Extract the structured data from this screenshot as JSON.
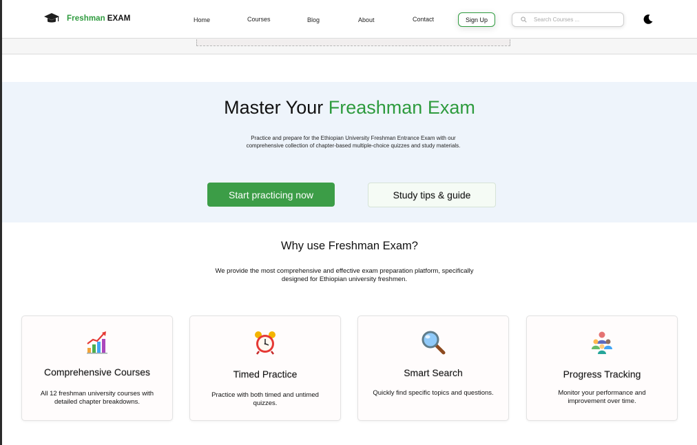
{
  "header": {
    "brand_part1": "Freshman",
    "brand_part2": "EXAM",
    "nav": [
      "Home",
      "Courses",
      "Blog",
      "About",
      "Contact"
    ],
    "signup_label": "Sign Up",
    "search_placeholder": "Search Courses ..."
  },
  "hero": {
    "title_part1": "Master Your",
    "title_part2": "Freashman Exam",
    "subtitle": "Practice and prepare for the Ethiopian University Freshman Entrance Exam with our comprehensive collection of chapter-based multiple-choice quizzes and study materials.",
    "primary_button": "Start practicing now",
    "secondary_button": "Study tips & guide"
  },
  "why": {
    "title": "Why use Freshman Exam?",
    "subtitle": "We provide the most comprehensive and effective exam preparation platform, specifically designed for Ethiopian university freshmen."
  },
  "features": [
    {
      "icon": "bar-chart-growth-icon",
      "title": "Comprehensive Courses",
      "desc": "All 12 freshman university courses with detailed chapter breakdowns."
    },
    {
      "icon": "alarm-clock-icon",
      "title": "Timed Practice",
      "desc": "Practice with both timed and untimed quizzes."
    },
    {
      "icon": "magnifying-glass-icon",
      "title": "Smart Search",
      "desc": "Quickly find specific topics and questions."
    },
    {
      "icon": "people-progress-icon",
      "title": "Progress Tracking",
      "desc": "Monitor your performance and improvement over time."
    }
  ],
  "colors": {
    "accent_green": "#2e9b3e",
    "button_green": "#3c9d47",
    "hero_bg": "#eef4fb"
  }
}
